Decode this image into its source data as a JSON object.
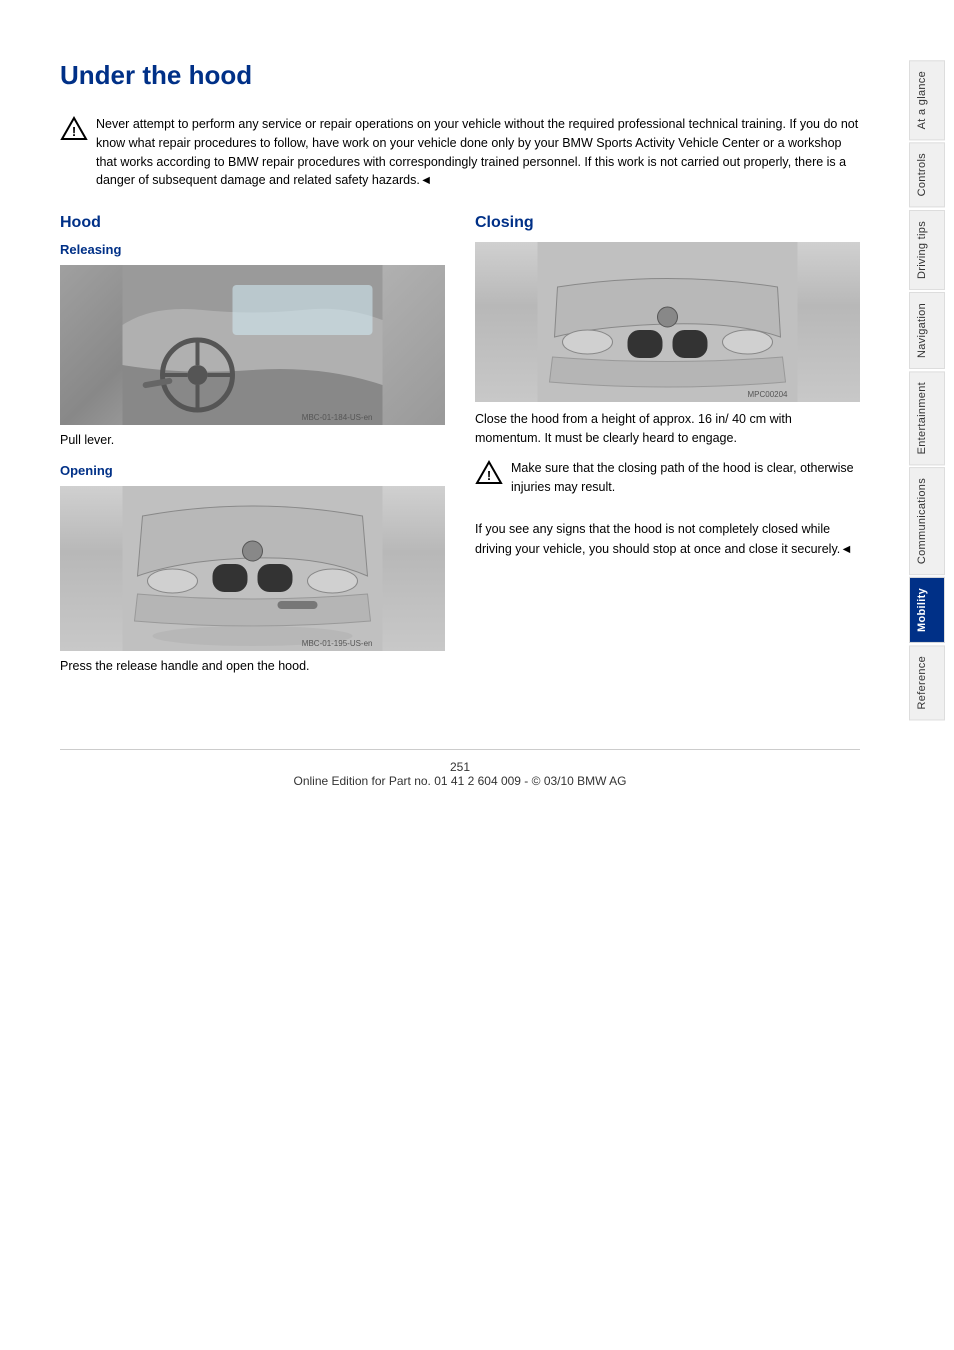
{
  "page": {
    "title": "Under the hood",
    "page_number": "251",
    "footer_text": "Online Edition for Part no. 01 41 2 604 009 - © 03/10 BMW AG"
  },
  "warning_block": {
    "text": "Never attempt to perform any service or repair operations on your vehicle without the required professional technical training. If you do not know what repair procedures to follow, have work on your vehicle done only by your BMW Sports Activity Vehicle Center or a workshop that works according to BMW repair procedures with correspondingly trained personnel. If this work is not carried out properly, there is a danger of subsequent damage and related safety hazards.◄"
  },
  "hood_section": {
    "heading": "Hood",
    "releasing": {
      "label": "Releasing",
      "caption": "Pull lever."
    },
    "opening": {
      "label": "Opening",
      "caption": "Press the release handle and open the hood."
    }
  },
  "closing_section": {
    "heading": "Closing",
    "body1": "Close the hood from a height of approx. 16 in/ 40 cm with momentum. It must be clearly heard to engage.",
    "warning_text": "Make sure that the closing path of the hood is clear, otherwise injuries may result.",
    "body2": "If you see any signs that the hood is not completely closed while driving your vehicle, you should stop at once and close it securely.◄"
  },
  "sidebar": {
    "tabs": [
      {
        "label": "At a glance",
        "active": false
      },
      {
        "label": "Controls",
        "active": false
      },
      {
        "label": "Driving tips",
        "active": false
      },
      {
        "label": "Navigation",
        "active": false
      },
      {
        "label": "Entertainment",
        "active": false
      },
      {
        "label": "Communications",
        "active": false
      },
      {
        "label": "Mobility",
        "active": true
      },
      {
        "label": "Reference",
        "active": false
      }
    ]
  }
}
